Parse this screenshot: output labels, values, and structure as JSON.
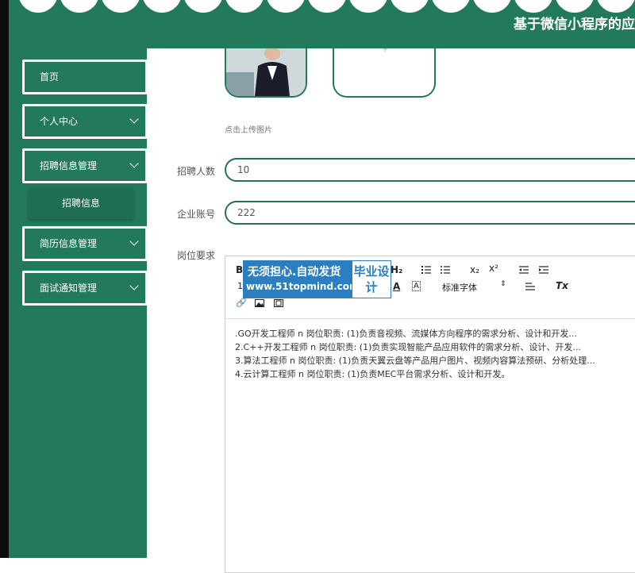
{
  "header": {
    "title": "基于微信小程序的应"
  },
  "sidebar": {
    "items": [
      {
        "label": "首页"
      },
      {
        "label": "个人中心"
      },
      {
        "label": "招聘信息管理"
      },
      {
        "label": "简历信息管理"
      },
      {
        "label": "面试通知管理"
      }
    ],
    "sub_item": "招聘信息"
  },
  "form": {
    "upload_hint": "点击上传图片",
    "upload_plus": "+",
    "fields": [
      {
        "label": "招聘人数",
        "value": "10"
      },
      {
        "label": "企业账号",
        "value": "222"
      }
    ],
    "requirement_label": "岗位要求"
  },
  "editor": {
    "toolbar": {
      "bold": "B",
      "size": "14",
      "heading": "H₂",
      "sub": "x₂",
      "sup": "x²",
      "font_select": "标准字体",
      "color_a": "A",
      "clear": "Tx"
    },
    "lines": [
      ".GO开发工程师 n 岗位职责: (1)负责音视频、流媒体方向程序的需求分析、设计和开发...",
      "2.C++开发工程师 n 岗位职责: (1)负责实现智能产品应用软件的需求分析、设计、开发...",
      "3.算法工程师 n 岗位职责: (1)负责天翼云盘等产品用户图片、视频内容算法预研、分析处理...",
      "4.云计算工程师 n 岗位职责: (1)负责MEC平台需求分析、设计和开发。"
    ]
  },
  "ad": {
    "line1": "无须担心.自动发货",
    "line2": "www.51topmind.com",
    "right": "毕业设计"
  }
}
